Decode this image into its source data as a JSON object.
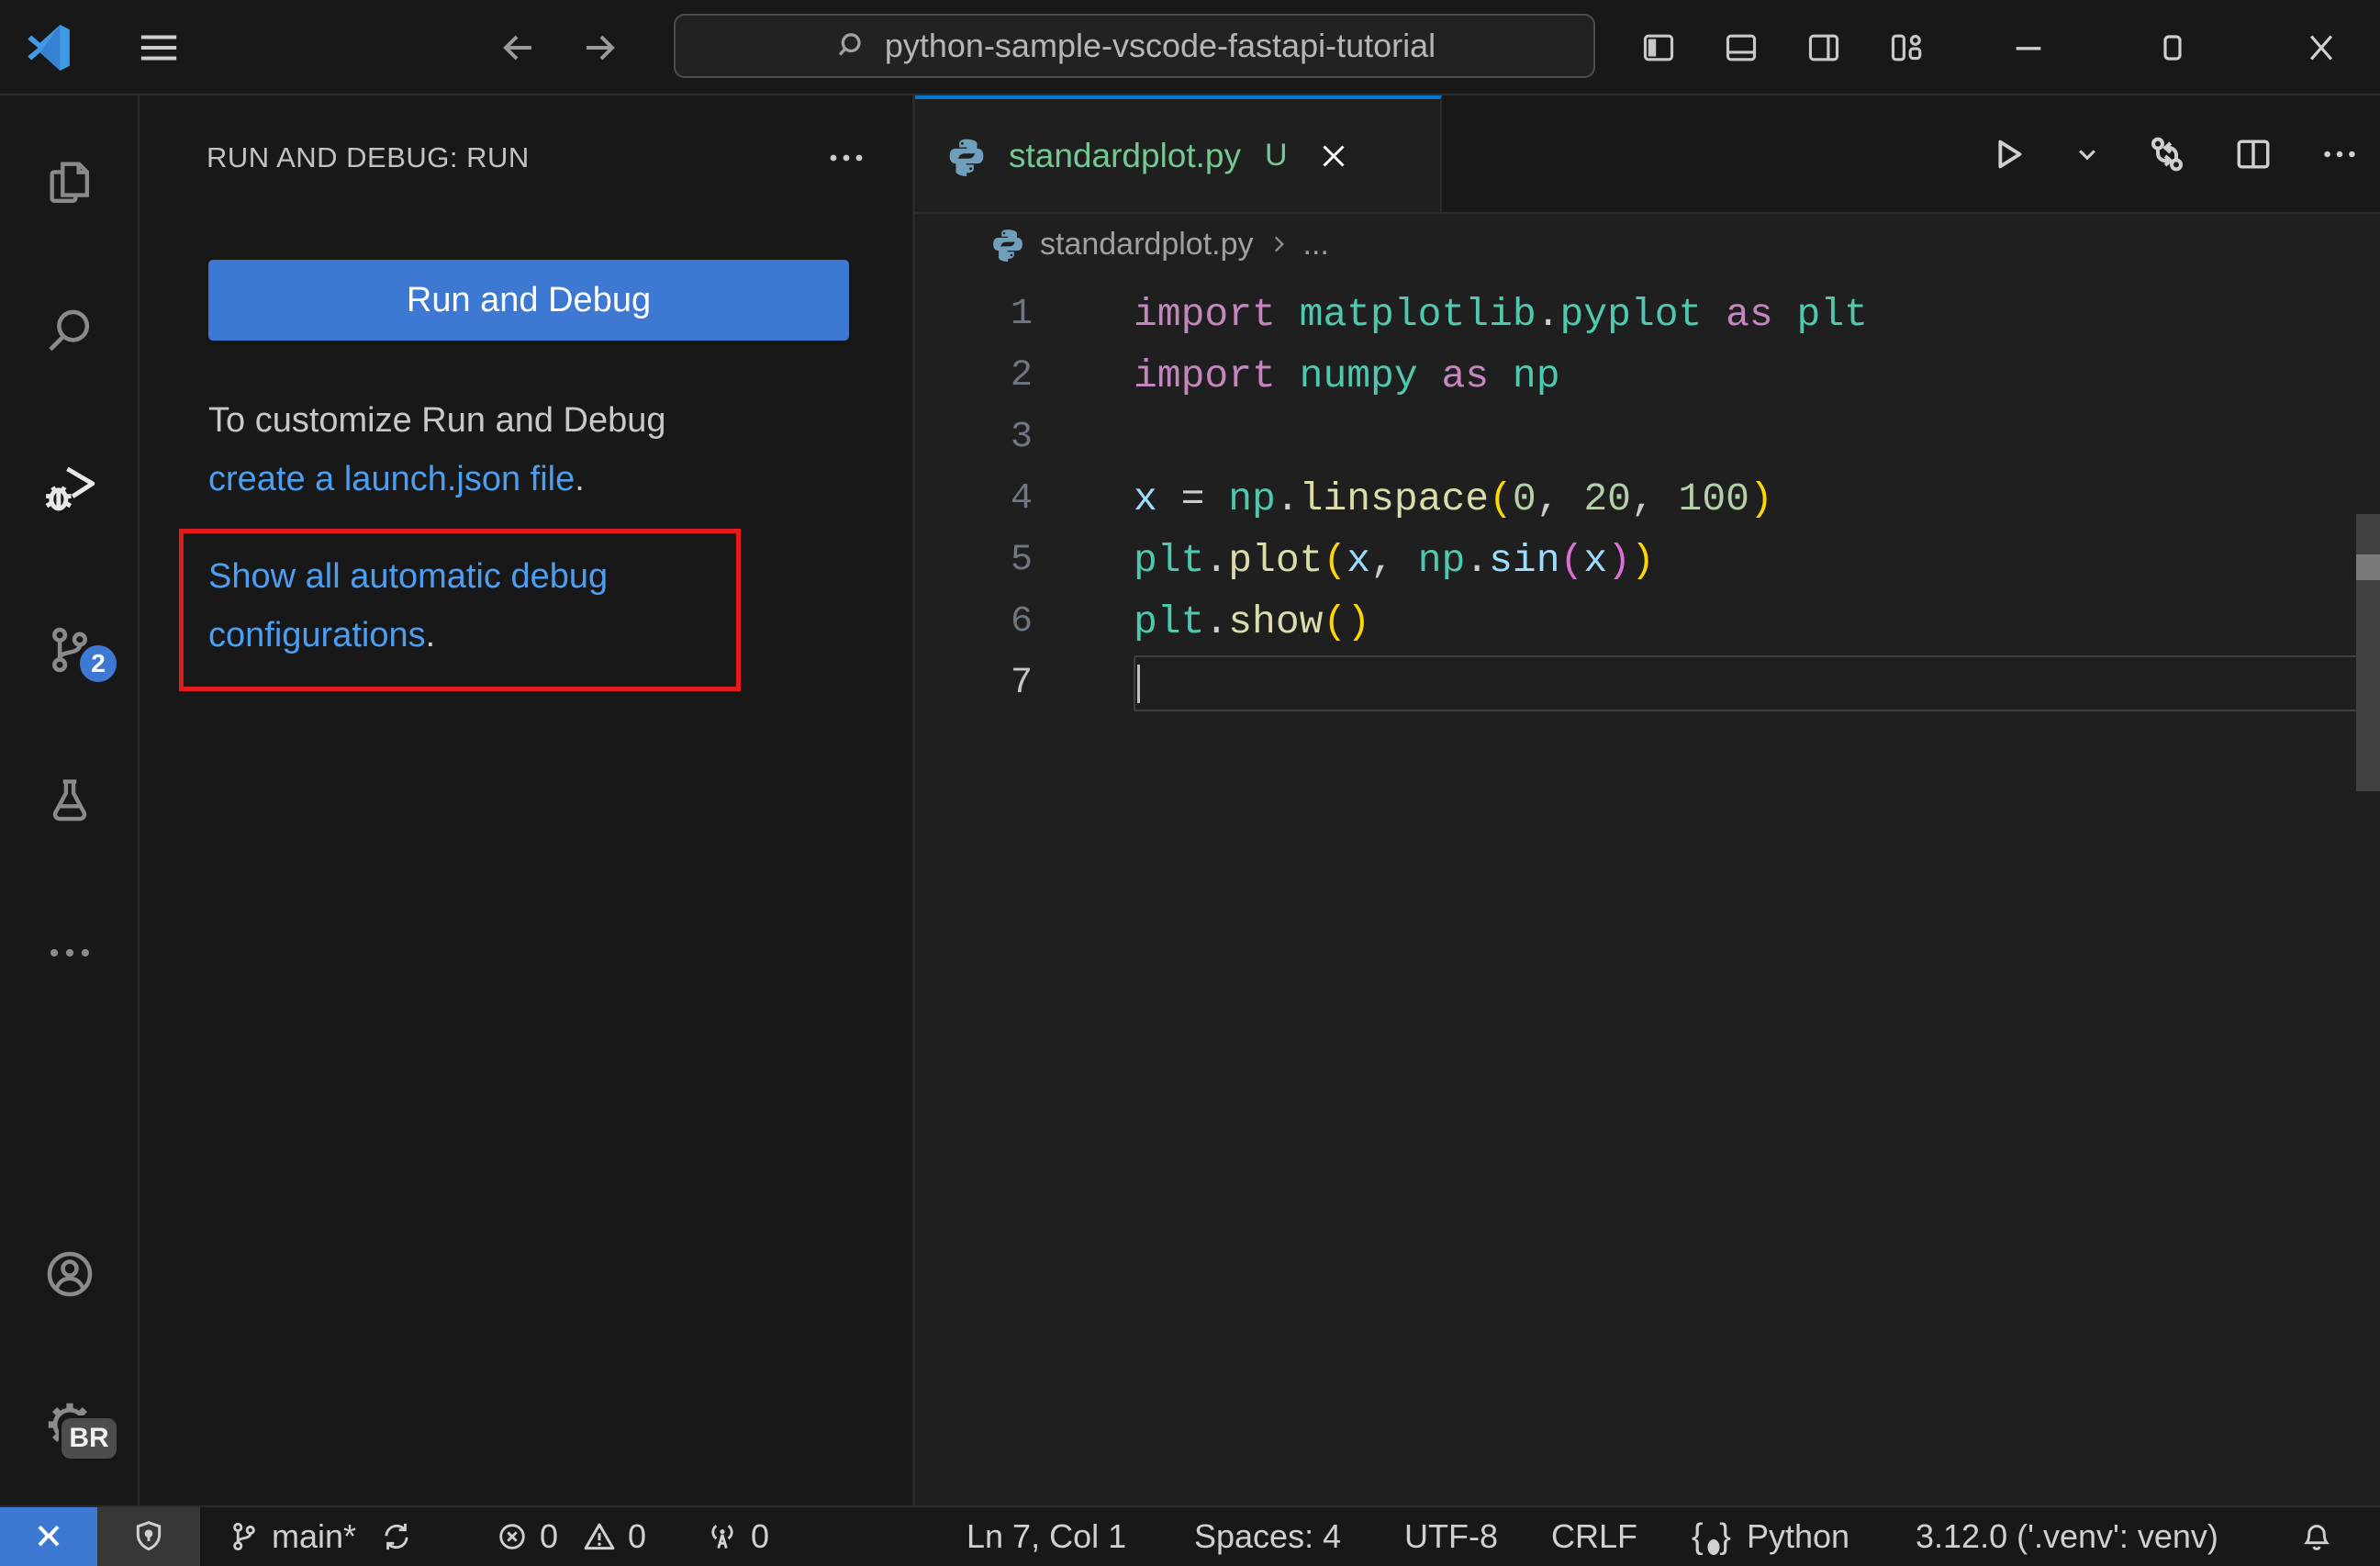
{
  "title_bar": {
    "search_text": "python-sample-vscode-fastapi-tutorial"
  },
  "activity_bar": {
    "scm_badge": "2",
    "profile_badge": "BR"
  },
  "sidebar": {
    "header": "RUN AND DEBUG: RUN",
    "run_button": "Run and Debug",
    "hint_text": "To customize Run and Debug ",
    "hint_link": "create a launch.json file",
    "hint_period": ".",
    "auto_link_line1": "Show all automatic debug",
    "auto_link_line2": "configurations",
    "auto_period": "."
  },
  "editor": {
    "tab_label": "standardplot.py",
    "tab_badge": "U",
    "breadcrumb_file": "standardplot.py",
    "breadcrumb_more": "...",
    "code": {
      "colors": {
        "kw": "#c586c0",
        "mod": "#4ec9b0",
        "punc": "#cccccc",
        "fn": "#dcdcaa",
        "num": "#b5cea8",
        "var": "#9cdcfe",
        "br1": "#ffd700",
        "br2": "#da70d6"
      },
      "lines": [
        {
          "n": "1",
          "tokens": [
            {
              "t": "import ",
              "c": "kw"
            },
            {
              "t": "matplotlib",
              "c": "mod"
            },
            {
              "t": ".",
              "c": "punc"
            },
            {
              "t": "pyplot",
              "c": "mod"
            },
            {
              "t": " as ",
              "c": "kw"
            },
            {
              "t": "plt",
              "c": "mod"
            }
          ]
        },
        {
          "n": "2",
          "tokens": [
            {
              "t": "import ",
              "c": "kw"
            },
            {
              "t": "numpy",
              "c": "mod"
            },
            {
              "t": " as ",
              "c": "kw"
            },
            {
              "t": "np",
              "c": "mod"
            }
          ]
        },
        {
          "n": "3",
          "tokens": []
        },
        {
          "n": "4",
          "tokens": [
            {
              "t": "x",
              "c": "var"
            },
            {
              "t": " = ",
              "c": "punc"
            },
            {
              "t": "np",
              "c": "mod"
            },
            {
              "t": ".",
              "c": "punc"
            },
            {
              "t": "linspace",
              "c": "fn"
            },
            {
              "t": "(",
              "c": "br1"
            },
            {
              "t": "0",
              "c": "num"
            },
            {
              "t": ", ",
              "c": "punc"
            },
            {
              "t": "20",
              "c": "num"
            },
            {
              "t": ", ",
              "c": "punc"
            },
            {
              "t": "100",
              "c": "num"
            },
            {
              "t": ")",
              "c": "br1"
            }
          ]
        },
        {
          "n": "5",
          "tokens": [
            {
              "t": "plt",
              "c": "mod"
            },
            {
              "t": ".",
              "c": "punc"
            },
            {
              "t": "plot",
              "c": "fn"
            },
            {
              "t": "(",
              "c": "br1"
            },
            {
              "t": "x",
              "c": "var"
            },
            {
              "t": ", ",
              "c": "punc"
            },
            {
              "t": "np",
              "c": "mod"
            },
            {
              "t": ".",
              "c": "punc"
            },
            {
              "t": "sin",
              "c": "var"
            },
            {
              "t": "(",
              "c": "br2"
            },
            {
              "t": "x",
              "c": "var"
            },
            {
              "t": ")",
              "c": "br2"
            },
            {
              "t": ")",
              "c": "br1"
            }
          ]
        },
        {
          "n": "6",
          "tokens": [
            {
              "t": "plt",
              "c": "mod"
            },
            {
              "t": ".",
              "c": "punc"
            },
            {
              "t": "show",
              "c": "fn"
            },
            {
              "t": "(",
              "c": "br1"
            },
            {
              "t": ")",
              "c": "br1"
            }
          ]
        },
        {
          "n": "7",
          "tokens": [],
          "current": true
        }
      ]
    }
  },
  "status_bar": {
    "branch": "main*",
    "errors": "0",
    "warnings": "0",
    "ports": "0",
    "line_col": "Ln 7, Col 1",
    "spaces": "Spaces: 4",
    "encoding": "UTF-8",
    "eol": "CRLF",
    "language": "Python",
    "interpreter": "3.12.0 ('.venv': venv)"
  }
}
